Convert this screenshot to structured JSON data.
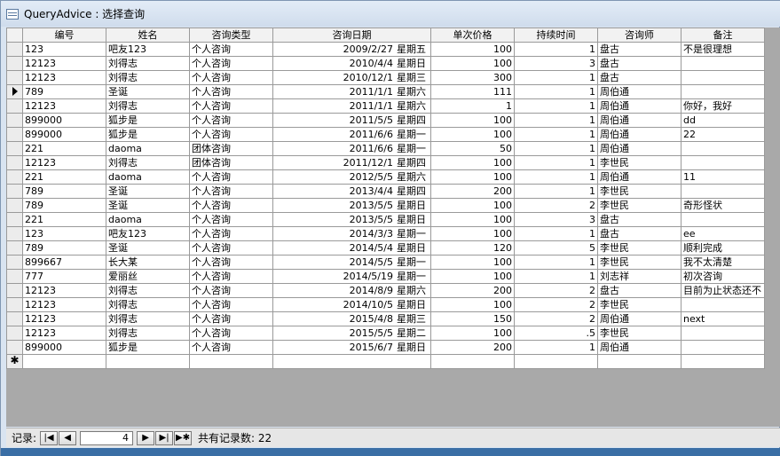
{
  "window": {
    "title": "QueryAdvice : 选择查询"
  },
  "table": {
    "columns": [
      "编号",
      "姓名",
      "咨询类型",
      "咨询日期",
      "单次价格",
      "持续时间",
      "咨询师",
      "备注"
    ],
    "current_row_index": 3,
    "new_row_marker": "✱",
    "rows": [
      {
        "id": "123",
        "name": "吧友123",
        "type": "个人咨询",
        "date": "2009/2/27",
        "weekday": "星期五",
        "price": "100",
        "duration": "1",
        "counselor": "盘古",
        "note": "不是很理想"
      },
      {
        "id": "12123",
        "name": "刘得志",
        "type": "个人咨询",
        "date": "2010/4/4",
        "weekday": "星期日",
        "price": "100",
        "duration": "3",
        "counselor": "盘古",
        "note": ""
      },
      {
        "id": "12123",
        "name": "刘得志",
        "type": "个人咨询",
        "date": "2010/12/1",
        "weekday": "星期三",
        "price": "300",
        "duration": "1",
        "counselor": "盘古",
        "note": ""
      },
      {
        "id": "789",
        "name": "圣诞",
        "type": "个人咨询",
        "date": "2011/1/1",
        "weekday": "星期六",
        "price": "111",
        "duration": "1",
        "counselor": "周伯通",
        "note": ""
      },
      {
        "id": "12123",
        "name": "刘得志",
        "type": "个人咨询",
        "date": "2011/1/1",
        "weekday": "星期六",
        "price": "1",
        "duration": "1",
        "counselor": "周伯通",
        "note": "你好，我好"
      },
      {
        "id": "899000",
        "name": "狐步是",
        "type": "个人咨询",
        "date": "2011/5/5",
        "weekday": "星期四",
        "price": "100",
        "duration": "1",
        "counselor": "周伯通",
        "note": "dd"
      },
      {
        "id": "899000",
        "name": "狐步是",
        "type": "个人咨询",
        "date": "2011/6/6",
        "weekday": "星期一",
        "price": "100",
        "duration": "1",
        "counselor": "周伯通",
        "note": "22"
      },
      {
        "id": "221",
        "name": "daoma",
        "type": "团体咨询",
        "date": "2011/6/6",
        "weekday": "星期一",
        "price": "50",
        "duration": "1",
        "counselor": "周伯通",
        "note": ""
      },
      {
        "id": "12123",
        "name": "刘得志",
        "type": "团体咨询",
        "date": "2011/12/1",
        "weekday": "星期四",
        "price": "100",
        "duration": "1",
        "counselor": "李世民",
        "note": ""
      },
      {
        "id": "221",
        "name": "daoma",
        "type": "个人咨询",
        "date": "2012/5/5",
        "weekday": "星期六",
        "price": "100",
        "duration": "1",
        "counselor": "周伯通",
        "note": "11"
      },
      {
        "id": "789",
        "name": "圣诞",
        "type": "个人咨询",
        "date": "2013/4/4",
        "weekday": "星期四",
        "price": "200",
        "duration": "1",
        "counselor": "李世民",
        "note": ""
      },
      {
        "id": "789",
        "name": "圣诞",
        "type": "个人咨询",
        "date": "2013/5/5",
        "weekday": "星期日",
        "price": "100",
        "duration": "2",
        "counselor": "李世民",
        "note": "奇形怪状"
      },
      {
        "id": "221",
        "name": "daoma",
        "type": "个人咨询",
        "date": "2013/5/5",
        "weekday": "星期日",
        "price": "100",
        "duration": "3",
        "counselor": "盘古",
        "note": ""
      },
      {
        "id": "123",
        "name": "吧友123",
        "type": "个人咨询",
        "date": "2014/3/3",
        "weekday": "星期一",
        "price": "100",
        "duration": "1",
        "counselor": "盘古",
        "note": "ee"
      },
      {
        "id": "789",
        "name": "圣诞",
        "type": "个人咨询",
        "date": "2014/5/4",
        "weekday": "星期日",
        "price": "120",
        "duration": "5",
        "counselor": "李世民",
        "note": "顺利完成"
      },
      {
        "id": "899667",
        "name": "长大某",
        "type": "个人咨询",
        "date": "2014/5/5",
        "weekday": "星期一",
        "price": "100",
        "duration": "1",
        "counselor": "李世民",
        "note": "我不太清楚"
      },
      {
        "id": "777",
        "name": "爱丽丝",
        "type": "个人咨询",
        "date": "2014/5/19",
        "weekday": "星期一",
        "price": "100",
        "duration": "1",
        "counselor": "刘志祥",
        "note": "初次咨询"
      },
      {
        "id": "12123",
        "name": "刘得志",
        "type": "个人咨询",
        "date": "2014/8/9",
        "weekday": "星期六",
        "price": "200",
        "duration": "2",
        "counselor": "盘古",
        "note": "目前为止状态还不"
      },
      {
        "id": "12123",
        "name": "刘得志",
        "type": "个人咨询",
        "date": "2014/10/5",
        "weekday": "星期日",
        "price": "100",
        "duration": "2",
        "counselor": "李世民",
        "note": ""
      },
      {
        "id": "12123",
        "name": "刘得志",
        "type": "个人咨询",
        "date": "2015/4/8",
        "weekday": "星期三",
        "price": "150",
        "duration": "2",
        "counselor": "周伯通",
        "note": "next"
      },
      {
        "id": "12123",
        "name": "刘得志",
        "type": "个人咨询",
        "date": "2015/5/5",
        "weekday": "星期二",
        "price": "100",
        "duration": ".5",
        "counselor": "李世民",
        "note": ""
      },
      {
        "id": "899000",
        "name": "狐步是",
        "type": "个人咨询",
        "date": "2015/6/7",
        "weekday": "星期日",
        "price": "200",
        "duration": "1",
        "counselor": "周伯通",
        "note": ""
      }
    ]
  },
  "navigator": {
    "label": "记录:",
    "first_icon": "first-record-icon",
    "prev_icon": "previous-record-icon",
    "next_icon": "next-record-icon",
    "last_icon": "last-record-icon",
    "new_icon": "new-record-icon",
    "current_record": "4",
    "count_text": "共有记录数: 22"
  }
}
